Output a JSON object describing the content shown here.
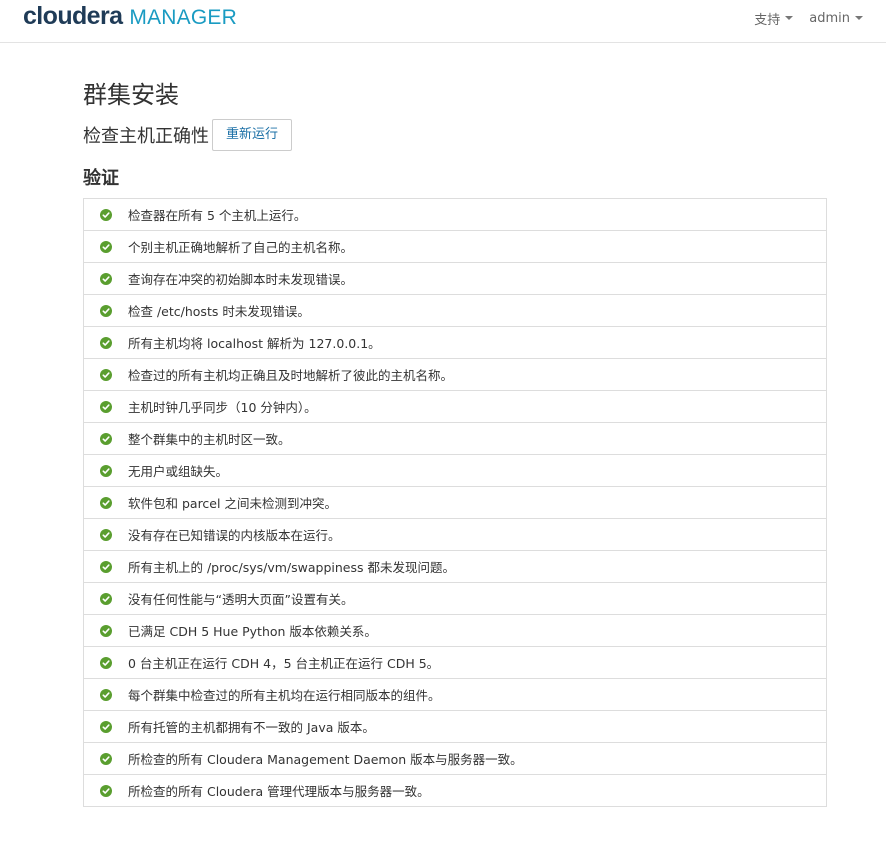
{
  "header": {
    "brand": {
      "logo_word": "cloudera",
      "product": "MANAGER"
    },
    "nav": [
      {
        "label": "支持"
      },
      {
        "label": "admin"
      }
    ]
  },
  "main": {
    "title": "群集安装",
    "subtitle": "检查主机正确性",
    "rerun_label": "重新运行",
    "section_title": "验证",
    "status_icon": "check-circle-icon",
    "status_color": "#5a9e2f",
    "checks": [
      {
        "text": "检查器在所有 5 个主机上运行。"
      },
      {
        "text": "个别主机正确地解析了自己的主机名称。"
      },
      {
        "text": "查询存在冲突的初始脚本时未发现错误。"
      },
      {
        "text": "检查 /etc/hosts 时未发现错误。"
      },
      {
        "text": "所有主机均将 localhost 解析为 127.0.0.1。"
      },
      {
        "text": "检查过的所有主机均正确且及时地解析了彼此的主机名称。"
      },
      {
        "text": "主机时钟几乎同步（10 分钟内）。"
      },
      {
        "text": "整个群集中的主机时区一致。"
      },
      {
        "text": "无用户或组缺失。"
      },
      {
        "text": "软件包和 parcel 之间未检测到冲突。"
      },
      {
        "text": "没有存在已知错误的内核版本在运行。"
      },
      {
        "text": "所有主机上的 /proc/sys/vm/swappiness 都未发现问题。"
      },
      {
        "text": "没有任何性能与“透明大页面”设置有关。"
      },
      {
        "text": "已满足 CDH 5 Hue Python 版本依赖关系。"
      },
      {
        "text": "0 台主机正在运行 CDH 4，5 台主机正在运行 CDH 5。"
      },
      {
        "text": "每个群集中检查过的所有主机均在运行相同版本的组件。"
      },
      {
        "text": "所有托管的主机都拥有不一致的 Java 版本。"
      },
      {
        "text": "所检查的所有 Cloudera Management Daemon 版本与服务器一致。"
      },
      {
        "text": "所检查的所有 Cloudera 管理代理版本与服务器一致。"
      }
    ]
  }
}
